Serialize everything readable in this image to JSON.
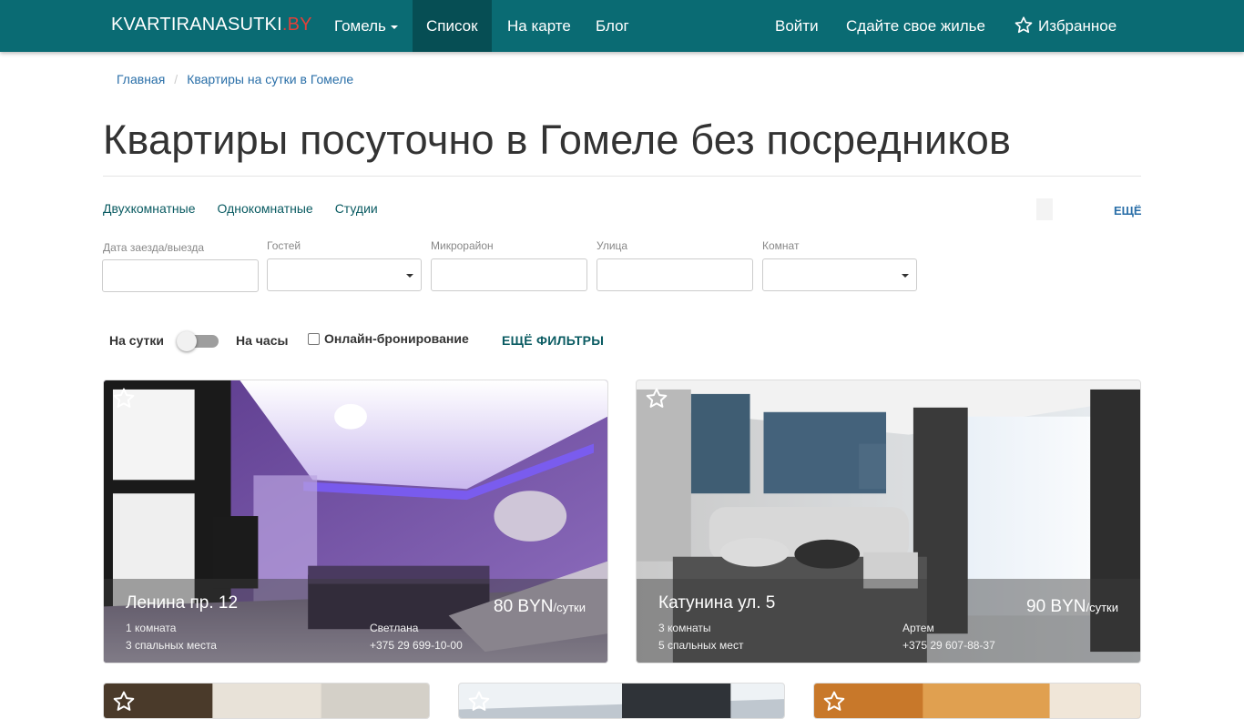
{
  "nav": {
    "brand_main": "KVARTIRANASUTKI",
    "brand_tld": ".BY",
    "city": "Гомель",
    "list": "Список",
    "map": "На карте",
    "blog": "Блог",
    "login": "Войти",
    "rent_out": "Сдайте свое жилье",
    "favorites": "Избранное"
  },
  "breadcrumb": {
    "home": "Главная",
    "current": "Квартиры на сутки в Гомеле"
  },
  "page_title": "Квартиры посуточно в Гомеле без посредников",
  "quick_links": {
    "two_room": "Двухкомнатные",
    "one_room": "Однокомнатные",
    "studios": "Студии",
    "more": "ЕЩЁ"
  },
  "filters": {
    "dates_label": "Дата заезда/выезда",
    "guests_label": "Гостей",
    "district_label": "Микрорайон",
    "street_label": "Улица",
    "rooms_label": "Комнат",
    "dates_value": "",
    "district_value": "",
    "street_value": ""
  },
  "toggles": {
    "daily": "На сутки",
    "hourly": "На часы",
    "online_booking": "Онлайн-бронирование",
    "more_filters": "ЕЩЁ ФИЛЬТРЫ",
    "hourly_on": false,
    "online_booking_checked": false
  },
  "listings": [
    {
      "title": "Ленина пр. 12",
      "rooms": "1 комната",
      "beds": "3 спальных места",
      "owner": "Светлана",
      "phone": "+375 29 699-10-00",
      "price": "80 BYN",
      "price_unit": "/сутки"
    },
    {
      "title": "Катунина ул. 5",
      "rooms": "3 комнаты",
      "beds": "5 спальных мест",
      "owner": "Артем",
      "phone": "+375 29 607-88-37",
      "price": "90 BYN",
      "price_unit": "/сутки"
    }
  ],
  "colors": {
    "navbar": "#0a6b73",
    "navbar_active": "#064e54",
    "brand_accent": "#e0413a",
    "link": "#2a6fa8"
  },
  "icons": {
    "favorites": "star-outline-icon",
    "select_caret": "caret-down-icon"
  }
}
